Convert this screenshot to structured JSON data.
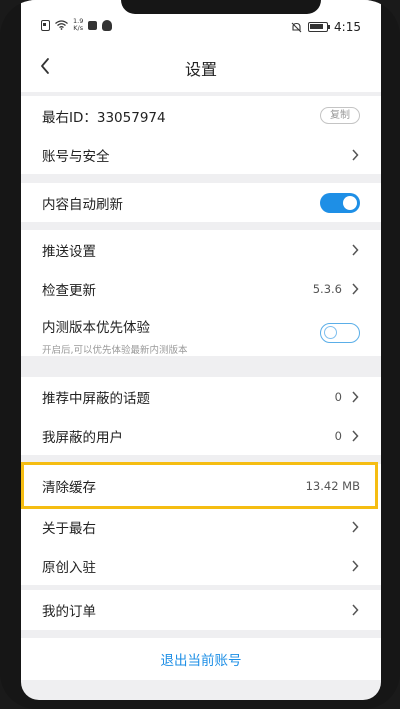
{
  "status_bar": {
    "net_speed_value": "1.9",
    "net_speed_unit": "K/s",
    "time": "4:15",
    "battery_level": 0.85
  },
  "header": {
    "title": "设置"
  },
  "account": {
    "id_label": "最右ID：33057974",
    "copy_label": "复制",
    "security_label": "账号与安全"
  },
  "content": {
    "auto_refresh_label": "内容自动刷新",
    "auto_refresh_on": true
  },
  "app": {
    "push_label": "推送设置",
    "update_label": "检查更新",
    "version": "5.3.6",
    "beta_label": "内测版本优先体验",
    "beta_sub": "开启后,可以优先体验最新内测版本",
    "beta_on": false
  },
  "block": {
    "topics_label": "推荐中屏蔽的话题",
    "topics_count": "0",
    "users_label": "我屏蔽的用户",
    "users_count": "0"
  },
  "misc": {
    "clear_cache_label": "清除缓存",
    "cache_size": "13.42 MB",
    "about_label": "关于最右",
    "creator_label": "原创入驻"
  },
  "orders": {
    "label": "我的订单"
  },
  "logout": {
    "label": "退出当前账号"
  },
  "colors": {
    "accent": "#1e8fe6",
    "highlight": "#f5bd12"
  }
}
